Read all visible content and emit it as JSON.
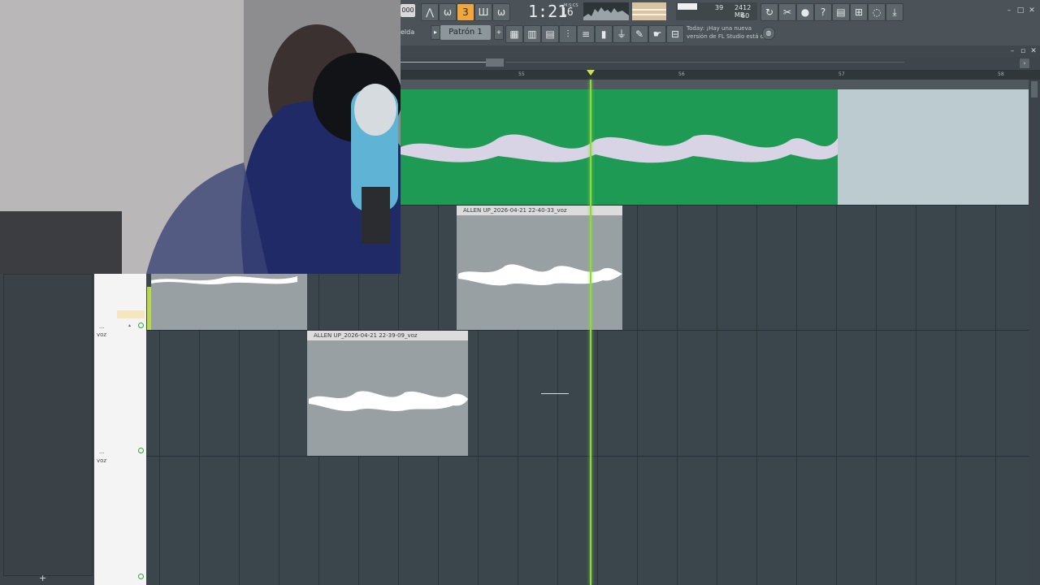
{
  "toolbar": {
    "tempo": "000",
    "time_main": "1:21",
    "time_frac": "16",
    "time_sub": "M:S:CS",
    "cpu_value": "39",
    "memory": "2412 MB",
    "voices": "60",
    "snap_label": "elda",
    "pattern_label": "Patrón 1",
    "news_line1": "Today: ¡Hay una nueva",
    "news_line2": "versión de FL Studio está d."
  },
  "ruler": {
    "bars": [
      "55",
      "56",
      "57",
      "58"
    ]
  },
  "clips": [
    {
      "title": "ALLEN UP_2026-04-21 22-40-33_voz"
    },
    {
      "title": "ALLEN UP_2026-04-21 22-39-09_voz"
    }
  ],
  "tracks": [
    {
      "label": "voz"
    },
    {
      "label": "voz"
    }
  ],
  "track_dots": [
    "...",
    "..."
  ],
  "add_track": "+",
  "colors": {
    "accent": "#f0a63a",
    "playhead": "#8fd83f",
    "audio_clip_green": "#1f9a54",
    "clip_grey": "#98a0a3"
  },
  "icons": [
    "metronome-icon",
    "wait-icon",
    "countdown-icon",
    "loop-record-icon",
    "undo-icon",
    "cut-icon",
    "mic-icon",
    "help-icon",
    "save-icon",
    "plugin-icon",
    "chat-icon",
    "download-icon"
  ]
}
